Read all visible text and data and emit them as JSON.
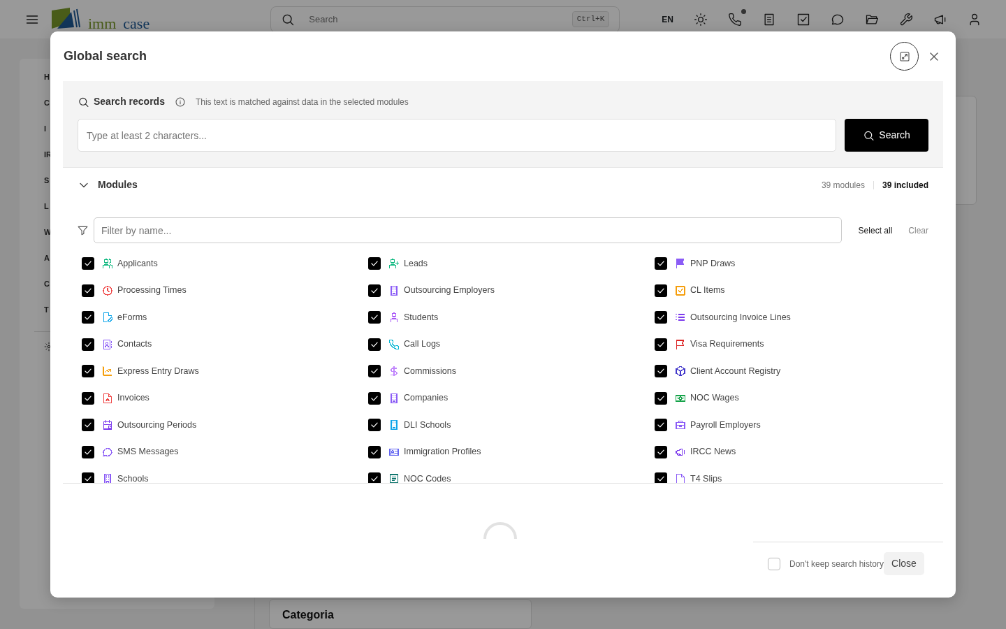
{
  "header": {
    "logo": {
      "first": "imm",
      "second": "case"
    },
    "search": {
      "placeholder": "Search",
      "shortcut": "Ctrl+K"
    },
    "language": "EN",
    "phone_notification": true
  },
  "sidebar": {
    "items": [
      "H",
      "C",
      "I",
      "IR",
      "S",
      "L",
      "W",
      "A",
      "C",
      "T"
    ]
  },
  "background_card": {
    "title": "Categoria"
  },
  "dialog": {
    "title": "Global search",
    "search": {
      "label": "Search records",
      "hint": "This text is matched against data in the selected modules",
      "placeholder": "Type at least 2 characters...",
      "button": "Search"
    },
    "modules": {
      "title": "Modules",
      "expanded": true,
      "count": "39 modules",
      "included": "39 included",
      "filter_placeholder": "Filter by name...",
      "select_all": "Select all",
      "clear": "Clear",
      "items": [
        {
          "label": "Applicants",
          "checked": true,
          "color": "#10b981"
        },
        {
          "label": "Leads",
          "checked": true,
          "color": "#10b981"
        },
        {
          "label": "PNP Draws",
          "checked": true,
          "color": "#8b5cf6"
        },
        {
          "label": "Processing Times",
          "checked": true,
          "color": "#ef4444"
        },
        {
          "label": "Outsourcing Employers",
          "checked": true,
          "color": "#8b5cf6"
        },
        {
          "label": "CL Items",
          "checked": true,
          "color": "#f59e0b"
        },
        {
          "label": "eForms",
          "checked": true,
          "color": "#0ea5e9"
        },
        {
          "label": "Students",
          "checked": true,
          "color": "#a855f7"
        },
        {
          "label": "Outsourcing Invoice Lines",
          "checked": true,
          "color": "#7c3aed"
        },
        {
          "label": "Contacts",
          "checked": true,
          "color": "#8b5cf6"
        },
        {
          "label": "Call Logs",
          "checked": true,
          "color": "#06b6d4"
        },
        {
          "label": "Visa Requirements",
          "checked": true,
          "color": "#dc2626"
        },
        {
          "label": "Express Entry Draws",
          "checked": true,
          "color": "#f59e0b"
        },
        {
          "label": "Commissions",
          "checked": true,
          "color": "#c084fc"
        },
        {
          "label": "Client Account Registry",
          "checked": true,
          "color": "#4338ca"
        },
        {
          "label": "Invoices",
          "checked": true,
          "color": "#ef4444"
        },
        {
          "label": "Companies",
          "checked": true,
          "color": "#8b5cf6"
        },
        {
          "label": "NOC Wages",
          "checked": true,
          "color": "#16a34a"
        },
        {
          "label": "Outsourcing Periods",
          "checked": true,
          "color": "#7c3aed"
        },
        {
          "label": "DLI Schools",
          "checked": true,
          "color": "#0ea5e9"
        },
        {
          "label": "Payroll Employers",
          "checked": true,
          "color": "#8b5cf6"
        },
        {
          "label": "SMS Messages",
          "checked": true,
          "color": "#8b5cf6"
        },
        {
          "label": "Immigration Profiles",
          "checked": true,
          "color": "#6366f1"
        },
        {
          "label": "IRCC News",
          "checked": true,
          "color": "#7c3aed"
        },
        {
          "label": "Schools",
          "checked": true,
          "color": "#8b5cf6"
        },
        {
          "label": "NOC Codes",
          "checked": true,
          "color": "#0f766e"
        },
        {
          "label": "T4 Slips",
          "checked": true,
          "color": "#8b5cf6"
        }
      ]
    },
    "loading": true,
    "footer": {
      "no_history_label": "Don't keep search history",
      "no_history_checked": false,
      "close": "Close"
    }
  }
}
